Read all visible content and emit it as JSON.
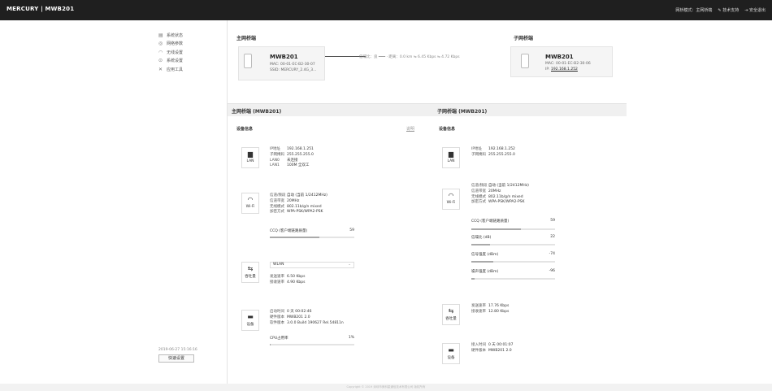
{
  "header": {
    "brand": "MERCURY | MWB201",
    "mode": "网桥模式：主网桥端",
    "support": "技术支持",
    "logout": "安全退出"
  },
  "sidebar": {
    "items": [
      {
        "icon": "status-icon",
        "label": "系统状态"
      },
      {
        "icon": "network-icon",
        "label": "网络参数"
      },
      {
        "icon": "wifi-icon",
        "label": "无线设置"
      },
      {
        "icon": "settings-icon",
        "label": "系统设置"
      },
      {
        "icon": "tools-icon",
        "label": "应用工具"
      }
    ],
    "datetime": "2019-06-27 15:16:16",
    "quick_setup": "快速设置"
  },
  "topology": {
    "primary_label": "主网桥端",
    "sub_label": "子网桥端",
    "primary": {
      "name": "MWB201",
      "mac": "MAC: 00-01-EC-B2-30-07",
      "ssid": "SSID: MERCURY_2.4G_3..."
    },
    "sub": {
      "name": "MWB201",
      "mac": "MAC: 00-01-EC-B2-30-06",
      "ip_prefix": "IP:",
      "ip": "192.168.1.252"
    },
    "link": "信噪比：良 ━━━ · 距离：0.0 km  ⇋ 6.45 Kbps  ⇋ 4.72 Kbps"
  },
  "primary_panel": {
    "title": "主网桥端 (MWB201)",
    "section": "设备信息",
    "link": "说明",
    "lan": {
      "icon_label": "LAN",
      "rows": [
        [
          "IP地址",
          "192.168.1.251"
        ],
        [
          "子网掩码",
          "255.255.255.0"
        ],
        [
          "LAN0",
          "未连接"
        ],
        [
          "LAN1",
          "100M 全双工"
        ]
      ]
    },
    "wifi": {
      "icon_label": "Wi-Fi",
      "rows": [
        [
          "信道/频段",
          "自动 (当前 1/2412MHz)"
        ],
        [
          "信道带宽",
          "20MHz"
        ],
        [
          "无线模式",
          "802.11b/g/n mixed"
        ],
        [
          "加密方式",
          "WPA-PSK/WPA2-PSK"
        ]
      ],
      "ccq_label": "CCQ (客户端链路质量)",
      "ccq": 59
    },
    "throughput": {
      "icon_label": "吞吐量",
      "select": "WLAN",
      "rows": [
        [
          "发送速率",
          "6.50 Kbps"
        ],
        [
          "接收速率",
          "4.90 Kbps"
        ]
      ]
    },
    "device": {
      "icon_label": "设备",
      "rows": [
        [
          "启动时间",
          "0 天 00:02:46"
        ],
        [
          "硬件版本",
          "MWB201 2.0"
        ],
        [
          "软件版本",
          "3.0.0 Build 190627 Rel.54811n"
        ]
      ],
      "cpu_label": "CPU占用率",
      "cpu_text": "1%",
      "cpu": 1
    }
  },
  "sub_panel": {
    "title": "子网桥端 (MWB201)",
    "section": "设备信息",
    "lan": {
      "icon_label": "LAN",
      "rows": [
        [
          "IP地址",
          "192.168.1.252"
        ],
        [
          "子网掩码",
          "255.255.255.0"
        ]
      ]
    },
    "wifi": {
      "icon_label": "Wi-Fi",
      "rows": [
        [
          "信道/频段",
          "自动 (当前 1/2412MHz)"
        ],
        [
          "信道带宽",
          "20MHz"
        ],
        [
          "无线模式",
          "802.11b/g/n mixed"
        ],
        [
          "加密方式",
          "WPA-PSK/WPA2-PSK"
        ]
      ],
      "bars": [
        {
          "label": "CCQ (客户端链路质量)",
          "value": "59",
          "fill": 0.59
        },
        {
          "label": "信噪比 (dB)",
          "value": "22",
          "fill": 0.22
        },
        {
          "label": "信号强度 (dBm)",
          "value": "-74",
          "fill": 0.26
        },
        {
          "label": "噪声强度 (dBm)",
          "value": "-96",
          "fill": 0.04
        }
      ]
    },
    "throughput": {
      "icon_label": "吞吐量",
      "rows": [
        [
          "发送速率",
          "17.76 Kbps"
        ],
        [
          "接收速率",
          "12.80 Kbps"
        ]
      ]
    },
    "device": {
      "icon_label": "设备",
      "rows": [
        [
          "接入时间",
          "0 天 00:01:07"
        ],
        [
          "硬件版本",
          "MWB201 2.0"
        ]
      ]
    }
  },
  "footer": "Copyright © 2019 深圳市美科星通信技术有限公司 版权所有"
}
